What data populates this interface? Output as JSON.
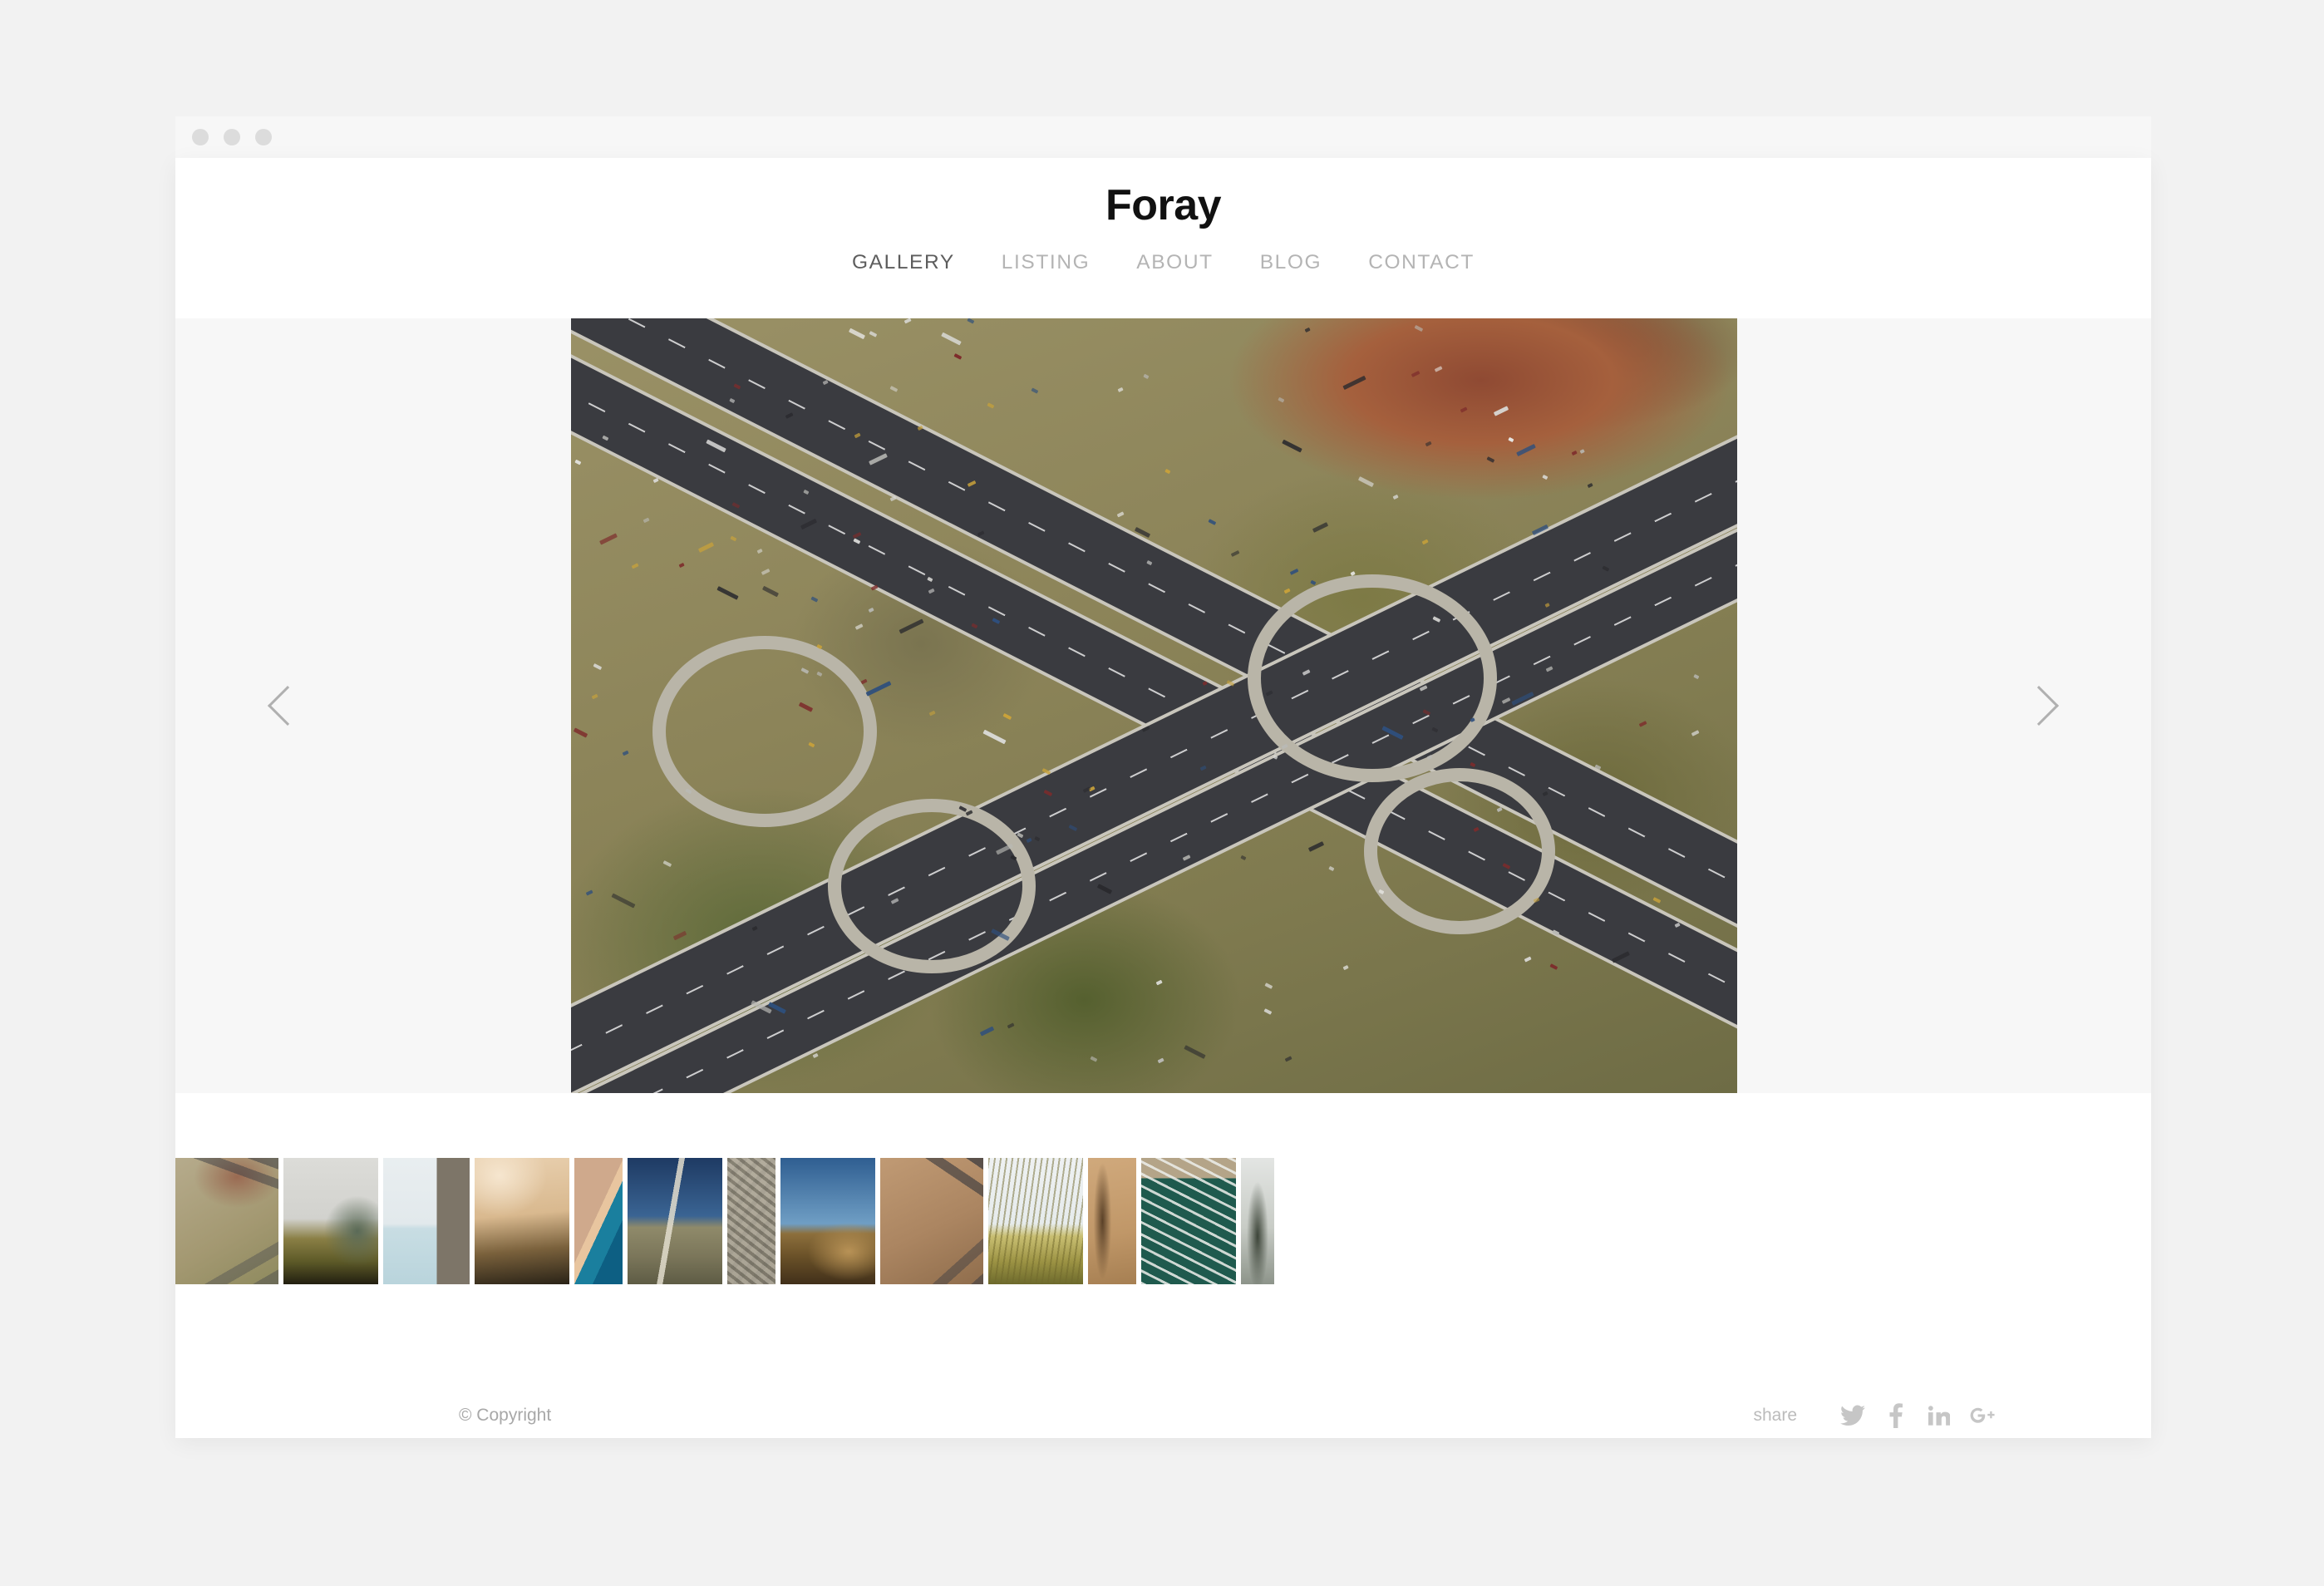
{
  "window": {
    "dots": [
      "close-dot",
      "minimize-dot",
      "maximize-dot"
    ],
    "chrome_color": "#f7f7f7",
    "page_bg": "#ffffff"
  },
  "header": {
    "site_title": "Foray",
    "nav": [
      {
        "label": "GALLERY",
        "active": true,
        "name": "nav-item-gallery"
      },
      {
        "label": "LISTING",
        "active": false,
        "name": "nav-item-listing"
      },
      {
        "label": "ABOUT",
        "active": false,
        "name": "nav-item-about"
      },
      {
        "label": "BLOG",
        "active": false,
        "name": "nav-item-blog"
      },
      {
        "label": "CONTACT",
        "active": false,
        "name": "nav-item-contact"
      }
    ],
    "active_color": "#5d5d5d",
    "inactive_color": "#b4b4b4"
  },
  "gallery": {
    "background": "#f7f7f7",
    "prev_arrow": "chevron-left-icon",
    "next_arrow": "chevron-right-icon",
    "arrow_color": "#b0b0b0",
    "hero": {
      "alt": "Aerial photograph of a highway cloverleaf interchange with trucks and cars",
      "selected_index": 0
    },
    "thumbnails": [
      {
        "alt": "Aerial highway interchange",
        "width": 124,
        "selected": true
      },
      {
        "alt": "Red-roof church on green hillside",
        "width": 114
      },
      {
        "alt": "Seabirds on pier pilings over pale blue water",
        "width": 104
      },
      {
        "alt": "Misty forested ridge at golden sunrise",
        "width": 114
      },
      {
        "alt": "Aerial coastline with turquoise sea",
        "width": 58
      },
      {
        "alt": "Dirt road through open plain under deep blue sky",
        "width": 114
      },
      {
        "alt": "Aerial suburban housing development",
        "width": 58
      },
      {
        "alt": "Golden hills beneath clear blue sky",
        "width": 114
      },
      {
        "alt": "Aerial desert highway junction",
        "width": 124
      },
      {
        "alt": "Windblown dune grass by the sea",
        "width": 114
      },
      {
        "alt": "Aerial dry riverbed in ochre earth",
        "width": 58
      },
      {
        "alt": "Aerial marina with rows of boat slips",
        "width": 114
      },
      {
        "alt": "Fog-shrouded evergreen forest",
        "width": 40
      }
    ]
  },
  "footer": {
    "copyright": "© Copyright",
    "share_label": "share",
    "social": [
      {
        "name": "twitter-icon",
        "glyph": "twitter"
      },
      {
        "name": "facebook-icon",
        "glyph": "f"
      },
      {
        "name": "linkedin-icon",
        "glyph": "in"
      },
      {
        "name": "googleplus-icon",
        "glyph": "g+"
      }
    ],
    "muted_color": "#c6c6c6"
  }
}
